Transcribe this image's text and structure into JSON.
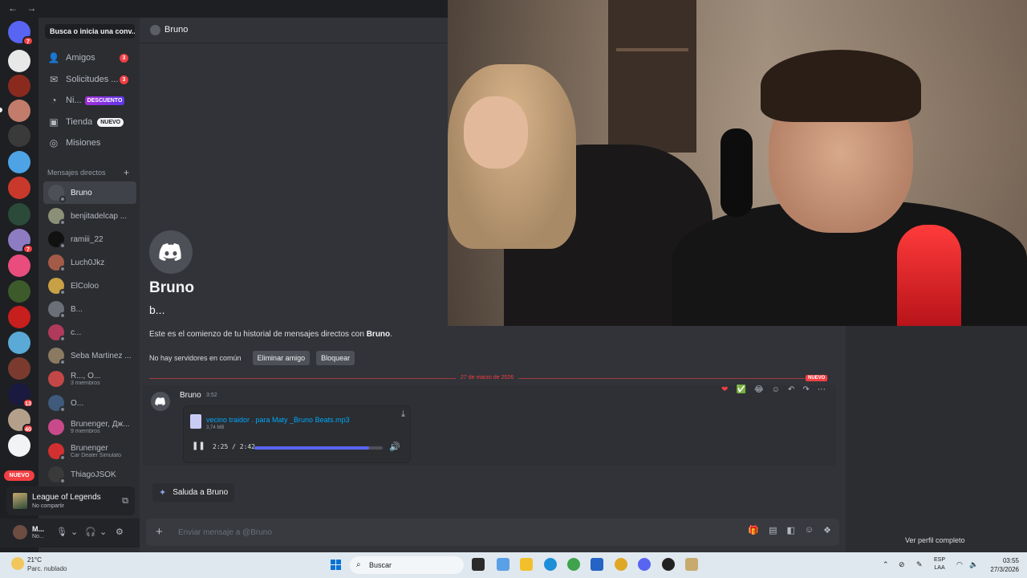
{
  "window": {
    "nav": "← →"
  },
  "header": {
    "search_label": "Busca o inicia una conv...",
    "channel_name": "Bruno"
  },
  "nav_items": [
    {
      "label": "Amigos",
      "count": "3"
    },
    {
      "label": "Solicitudes ...",
      "count": "3"
    },
    {
      "label": "Ni...",
      "badge": "DESCUENTO"
    },
    {
      "label": "Tienda",
      "badge": "NUEVO"
    },
    {
      "label": "Misiones"
    }
  ],
  "server_badges": [
    "7",
    "7",
    "13",
    "40"
  ],
  "server_new_label": "NUEVO",
  "dm_section": {
    "title": "Mensajes directos",
    "add": "+"
  },
  "dms": [
    {
      "name": "Bruno"
    },
    {
      "name": "benjitadelcap ..."
    },
    {
      "name": "ramiii_22"
    },
    {
      "name": "Luch0Jkz"
    },
    {
      "name": "ElColoo"
    },
    {
      "name": "B..."
    },
    {
      "name": "c..."
    },
    {
      "name": "Seba Martinez ..."
    },
    {
      "name": "R..., O...",
      "sub": "3 miembros"
    },
    {
      "name": "O..."
    },
    {
      "name": "Brunenger, Дж...",
      "sub": "9 miembros"
    },
    {
      "name": "Brunenger",
      "sub": "Car Dealer Simulato"
    },
    {
      "name": "ThiagoJSOK"
    }
  ],
  "activity": {
    "title": "League of Legends",
    "subtitle": "No compartir"
  },
  "user": {
    "name": "M...",
    "status": "No..."
  },
  "intro": {
    "name": "Bruno",
    "username": "b...",
    "text_prefix": "Este es el comienzo de tu historial de mensajes directos con ",
    "text_name": "Bruno",
    "text_suffix": ".",
    "no_common": "No hay servidores en común",
    "remove_friend": "Eliminar amigo",
    "block": "Bloquear"
  },
  "divider": {
    "date": "27 de marzo de 2026",
    "new_tag": "NUEVO"
  },
  "message": {
    "author": "Bruno",
    "time": "3:52",
    "file_name": "vecino traidor . para Maty _Bruno Beats.mp3",
    "file_size": "3,74 MB",
    "playback": "2:25 / 2:42",
    "progress": 0.895
  },
  "reactions": [
    "❤",
    "✅",
    "😂",
    "☺",
    "↶",
    "↷",
    "⋯"
  ],
  "wave": {
    "label": "Saluda a Bruno"
  },
  "composer": {
    "placeholder": "Enviar mensaje a @Bruno"
  },
  "profile": {
    "link": "Ver perfil completo"
  },
  "taskbar": {
    "temp": "21°C",
    "condition": "Parc. nublado",
    "search": "Buscar",
    "lang_1": "ESP",
    "lang_2": "LAA",
    "time": "03:55",
    "date": "27/3/2026"
  }
}
